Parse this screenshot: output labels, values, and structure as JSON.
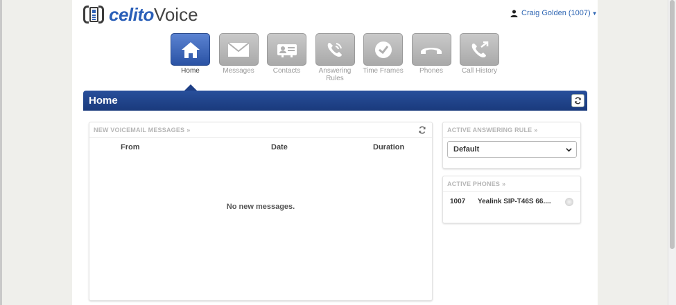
{
  "header": {
    "logo_bold": "celito",
    "logo_light": "Voice",
    "user_label": "Craig Golden (1007)"
  },
  "nav": {
    "items": [
      {
        "label": "Home",
        "icon": "home-icon",
        "active": true
      },
      {
        "label": "Messages",
        "icon": "envelope-icon"
      },
      {
        "label": "Contacts",
        "icon": "contact-card-icon"
      },
      {
        "label": "Answering Rules",
        "icon": "phone-ringing-icon"
      },
      {
        "label": "Time Frames",
        "icon": "clock-icon"
      },
      {
        "label": "Phones",
        "icon": "handset-icon"
      },
      {
        "label": "Call History",
        "icon": "call-history-icon"
      }
    ]
  },
  "page": {
    "title": "Home"
  },
  "voicemail": {
    "heading": "NEW VOICEMAIL MESSAGES",
    "arrows": "»",
    "columns": {
      "from": "From",
      "date": "Date",
      "duration": "Duration"
    },
    "empty": "No new messages."
  },
  "answering_rule": {
    "heading": "ACTIVE ANSWERING RULE",
    "arrows": "»",
    "selected": "Default"
  },
  "active_phones": {
    "heading": "ACTIVE PHONES",
    "arrows": "»",
    "rows": [
      {
        "ext": "1007",
        "device": "Yealink SIP-T46S 66...."
      }
    ]
  },
  "colors": {
    "accent_blue": "#2a5fb8",
    "title_bar": "#1f4289",
    "tile_grey": "#b5b5b5"
  }
}
